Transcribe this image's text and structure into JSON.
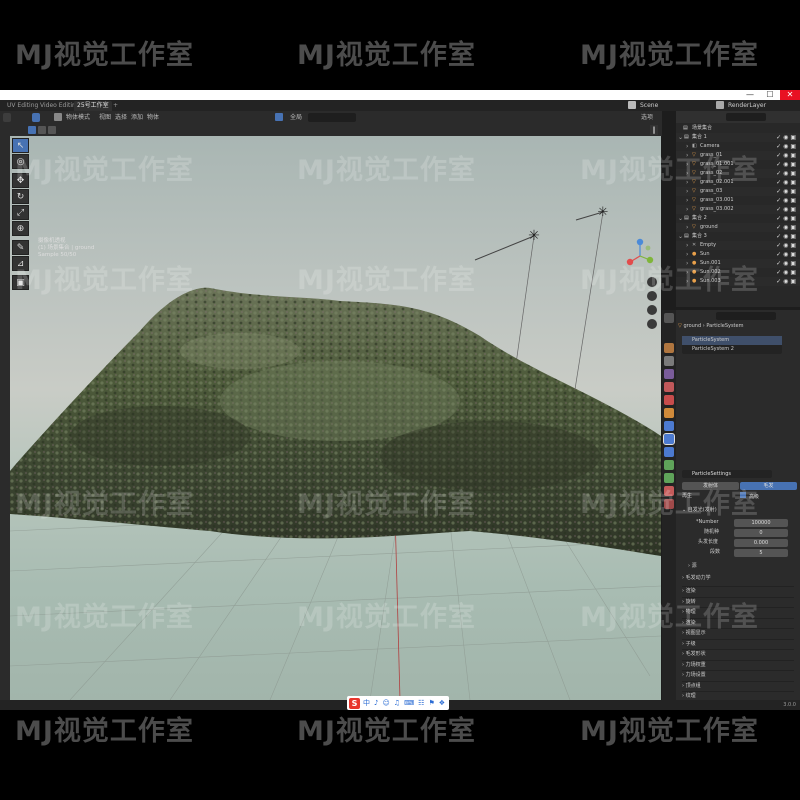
{
  "watermark": {
    "text": "MJ视觉工作室"
  },
  "window": {
    "minimize": "—",
    "maximize": "☐",
    "close": "✕"
  },
  "topbar": {
    "tabs": [
      "UV Editing",
      "Video Editing",
      "25号工作室"
    ],
    "add_tab": "+",
    "scene_label": "Scene",
    "layer_label": "RenderLayer"
  },
  "viewport_header": {
    "mode": "物体模式",
    "menus": [
      "视图",
      "选择",
      "添加",
      "物体"
    ],
    "orientation": "全局",
    "options": "选项"
  },
  "viewport_overlay": {
    "line1": "摄像机透视",
    "line2": "(1) 场景集合 | ground",
    "line3": "Sample 50/50"
  },
  "outliner": {
    "title": "场景集合",
    "rows": [
      {
        "label": "集合 1",
        "indent": 1,
        "type": "collection"
      },
      {
        "label": "Camera",
        "indent": 2,
        "type": "camera"
      },
      {
        "label": "grass_01",
        "indent": 2,
        "type": "mesh"
      },
      {
        "label": "grass_01.001",
        "indent": 2,
        "type": "mesh"
      },
      {
        "label": "grass_02",
        "indent": 2,
        "type": "mesh"
      },
      {
        "label": "grass_02.001",
        "indent": 2,
        "type": "mesh"
      },
      {
        "label": "grass_03",
        "indent": 2,
        "type": "mesh"
      },
      {
        "label": "grass_03.001",
        "indent": 2,
        "type": "mesh"
      },
      {
        "label": "grass_03.002",
        "indent": 2,
        "type": "mesh"
      },
      {
        "label": "集合 2",
        "indent": 1,
        "type": "collection"
      },
      {
        "label": "ground",
        "indent": 2,
        "type": "mesh"
      },
      {
        "label": "集合 3",
        "indent": 1,
        "type": "collection"
      },
      {
        "label": "Empty",
        "indent": 2,
        "type": "empty"
      },
      {
        "label": "Sun",
        "indent": 2,
        "type": "light"
      },
      {
        "label": "Sun.001",
        "indent": 2,
        "type": "light"
      },
      {
        "label": "Sun.002",
        "indent": 2,
        "type": "light"
      },
      {
        "label": "Sun.003",
        "indent": 2,
        "type": "light"
      }
    ]
  },
  "properties": {
    "breadcrumb_obj": "ground",
    "breadcrumb_sys": "ParticleSystem",
    "systems": [
      "ParticleSystem",
      "ParticleSystem 2"
    ],
    "settings_name": "ParticleSettings",
    "type_emitter": "发射体",
    "type_hair": "毛发",
    "regrow_label": "再生",
    "advanced_label": "高级",
    "emission_title": "自发光(发射)",
    "number_label": "*Number",
    "number_value": "100000",
    "seed_label": "随机种",
    "seed_value": "0",
    "hairlen_label": "头发长度",
    "hairlen_value": "0.000",
    "segments_label": "段数",
    "segments_value": "5",
    "source_label": "源",
    "dynamics_label": "毛发动力学",
    "panels": [
      "渲染",
      "旋转",
      "物理",
      "渲染",
      "视图显示",
      "子级",
      "毛发形状",
      "力场权重",
      "力场设置",
      "顶点组",
      "纹理",
      "自定义属性"
    ]
  },
  "statusbar": {
    "version": "3.0.0"
  },
  "ime": {
    "logo": "S",
    "items": [
      "中",
      "♪",
      "☺",
      "♫",
      "⌨",
      "☷",
      "⚑",
      "❖"
    ]
  }
}
